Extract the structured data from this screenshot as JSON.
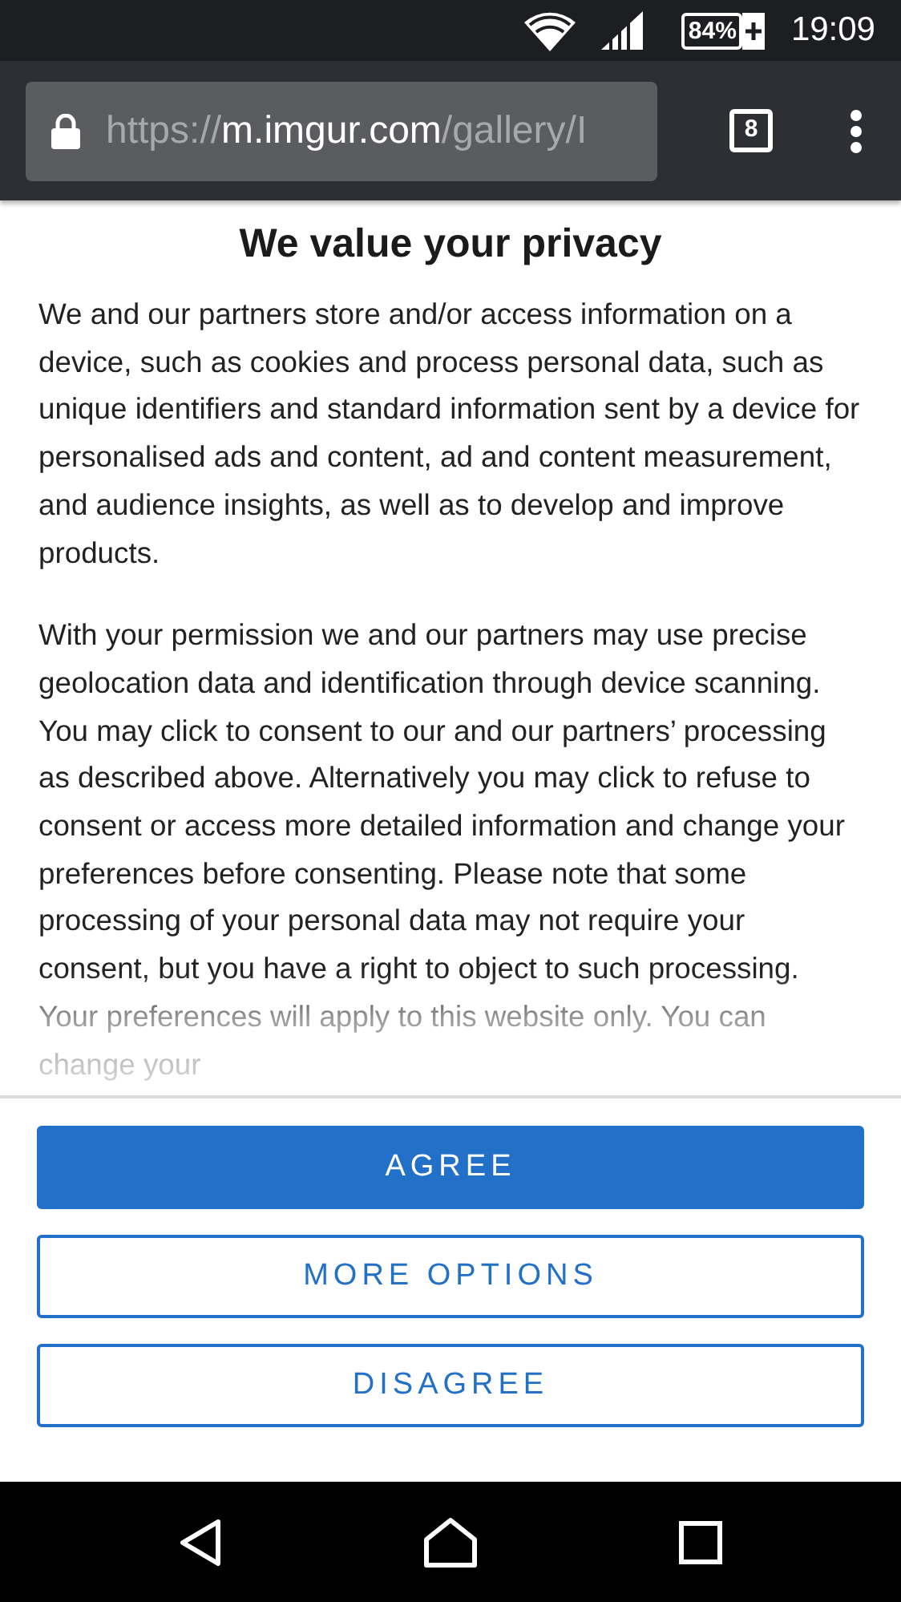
{
  "status_bar": {
    "battery": "84%",
    "time": "19:09"
  },
  "browser": {
    "url_scheme": "https://",
    "url_host": "m.imgur.com",
    "url_path": "/gallery/I",
    "tab_count": "8"
  },
  "dialog": {
    "title": "We value your privacy",
    "paragraphs": [
      "We and our partners store and/or access information on a device, such as cookies and process personal data, such as unique identifiers and standard information sent by a device for personalised ads and content, ad and content measurement, and audience insights, as well as to develop and improve products.",
      "With your permission we and our partners may use precise geolocation data and identification through device scanning. You may click to consent to our and our partners’ processing as described above. Alternatively you may click to refuse to consent or access more detailed information and change your preferences before consenting. Please note that some processing of your personal data may not require your consent, but you have a right to object to such processing. Your preferences will apply to this website only. You can change your"
    ],
    "buttons": [
      {
        "label": "AGREE",
        "kind": "primary"
      },
      {
        "label": "MORE OPTIONS",
        "kind": "outline"
      },
      {
        "label": "DISAGREE",
        "kind": "outline"
      }
    ]
  }
}
